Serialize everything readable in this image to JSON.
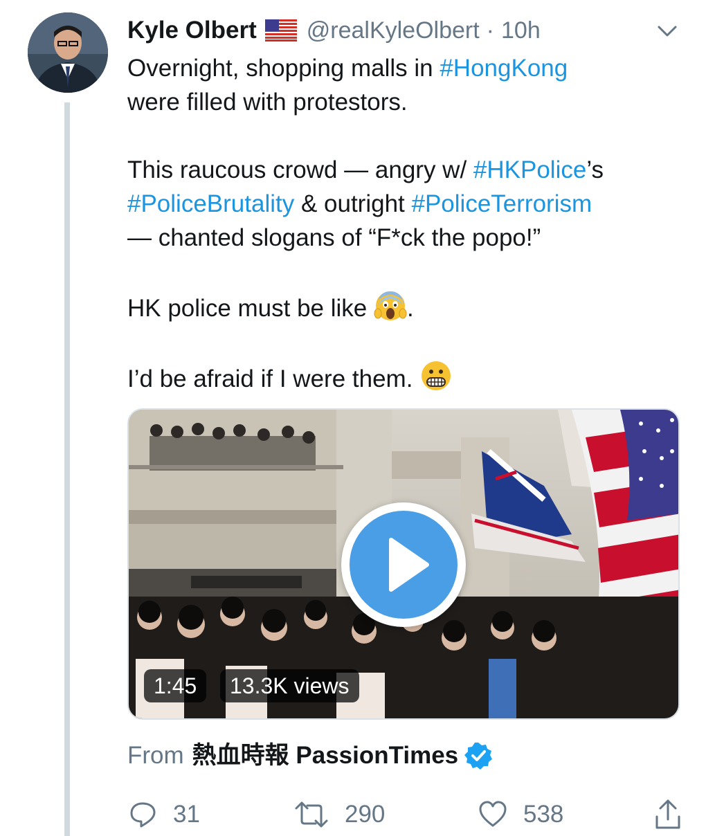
{
  "author": {
    "name": "Kyle Olbert",
    "flag": "flag-us-icon",
    "handle": "@realKyleOlbert",
    "separator": "·",
    "time": "10h"
  },
  "tweet": {
    "p1_a": "Overnight, shopping malls in ",
    "p1_tag": "#HongKong",
    "p1_b": "were filled with protestors.",
    "p2_a": "This raucous crowd — angry w/ ",
    "p2_tag1": "#HKPolice",
    "p2_b": "’s",
    "p2_tag2": "#PoliceBrutality",
    "p2_c": " & outright ",
    "p2_tag3": "#PoliceTerrorism",
    "p2_d": "— chanted slogans of “F*ck the popo!”",
    "p3_a": "HK police must be like ",
    "p3_b": ".",
    "p4_a": "I’d be afraid if I were them. "
  },
  "media": {
    "duration": "1:45",
    "views": "13.3K views"
  },
  "source": {
    "label": "From",
    "name": "熱血時報 PassionTimes"
  },
  "actions": {
    "replies": "31",
    "retweets": "290",
    "likes": "538"
  },
  "colors": {
    "link": "#1b95e0",
    "secondary": "#657786",
    "play": "#4a9ee6"
  }
}
